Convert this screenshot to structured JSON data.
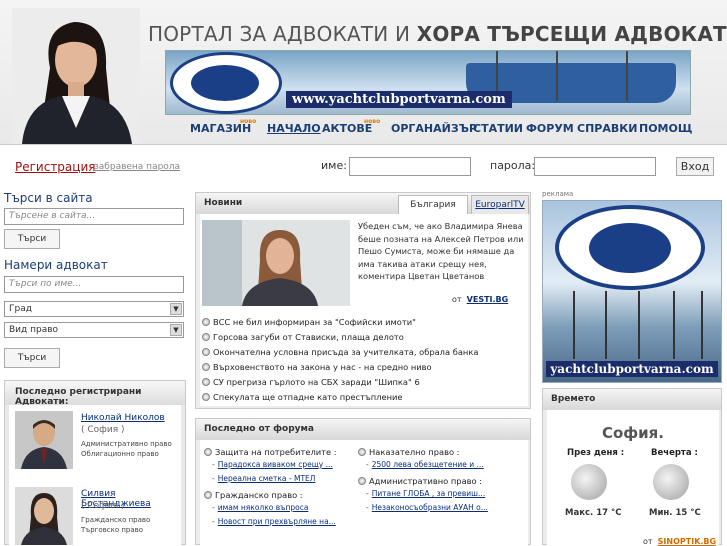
{
  "header": {
    "title_part1": "ПОРТАЛ ЗА АДВОКАТИ И ",
    "title_part2": "ХОРА ТЪРСЕЩИ АДВОКАТИ",
    "banner_url": "www.yachtclubportvarna.com"
  },
  "nav": {
    "items": [
      {
        "label": "МАГАЗИН",
        "badge": "ново"
      },
      {
        "label": "НАЧАЛО"
      },
      {
        "label": "АКТОВЕ",
        "badge": "ново"
      },
      {
        "label": "ОРГАНАЙЗЪР"
      },
      {
        "label": "СТАТИИ"
      },
      {
        "label": "ФОРУМ"
      },
      {
        "label": "СПРАВКИ"
      },
      {
        "label": "ПОМОЩ"
      }
    ]
  },
  "login": {
    "register": "Регистрация",
    "forgot": "забравена парола",
    "username_label": "име:",
    "password_label": "парола:",
    "submit": "Вход"
  },
  "search": {
    "title": "Търси в сайта",
    "placeholder": "Търсене в сайта...",
    "button": "Търси"
  },
  "find_lawyer": {
    "title": "Намери адвокат",
    "placeholder": "Търси по име...",
    "city_select": "Град",
    "law_select": "Вид право",
    "button": "Търси"
  },
  "recent_lawyers": {
    "title": "Последно регистрирани Адвокати:",
    "items": [
      {
        "name": "Николай Николов",
        "city": "( София )",
        "fields": [
          "Административно право",
          "Облигационно право"
        ]
      },
      {
        "name": "Силвия Бостанджиева",
        "city": "( София )",
        "fields": [
          "Гражданско право",
          "Търговско право"
        ]
      }
    ]
  },
  "news": {
    "title": "Новини",
    "tabs": [
      "България",
      "EuroparlTV"
    ],
    "lead_text": "Убеден съм, че ако Владимира Янева беше позната на Алексей Петров или Пешо Сумиста, може би нямаше да има такива атаки срещу нея, коментира Цветан Цветанов",
    "source_prefix": "от",
    "source": "VESTI.BG",
    "items": [
      "ВСС не бил информиран за \"Софийски имоти\"",
      "Горсова загуби от Стависки, плаща делото",
      "Окончателна условна присъда за учителката, обрала банка",
      "Върховенството на закона у нас - на средно ниво",
      "СУ прегриза гърлото на СБХ заради \"Шипка\" 6",
      "Спекулата ще отпадне като престъпление"
    ]
  },
  "forum": {
    "title": "Последно от форума",
    "left": [
      {
        "category": "Защита на потребителите :",
        "posts": [
          "Парадокса виваком срещу ...",
          "Нереална сметка - МТЕЛ"
        ]
      },
      {
        "category": "Гражданско право :",
        "posts": [
          "имам няколко въпроса",
          "Новост при прехвърляне на..."
        ]
      }
    ],
    "right": [
      {
        "category": "Наказателно право :",
        "posts": [
          "2500 лева обезщетение и ..."
        ]
      },
      {
        "category": "Административно право :",
        "posts": [
          "Питане ГЛОБА , за превиш...",
          "Незаконосъобразни АУАН о..."
        ]
      }
    ]
  },
  "ad": {
    "label": "реклама",
    "url": "yachtclubportvarna.com"
  },
  "weather": {
    "title": "Времето",
    "city": "София.",
    "today_label": "През деня :",
    "evening_label": "Вечерта :",
    "max": "Макс. 17 °C",
    "min": "Мин. 15 °C",
    "source_prefix": "от",
    "source": "SINOPTIK.BG"
  }
}
